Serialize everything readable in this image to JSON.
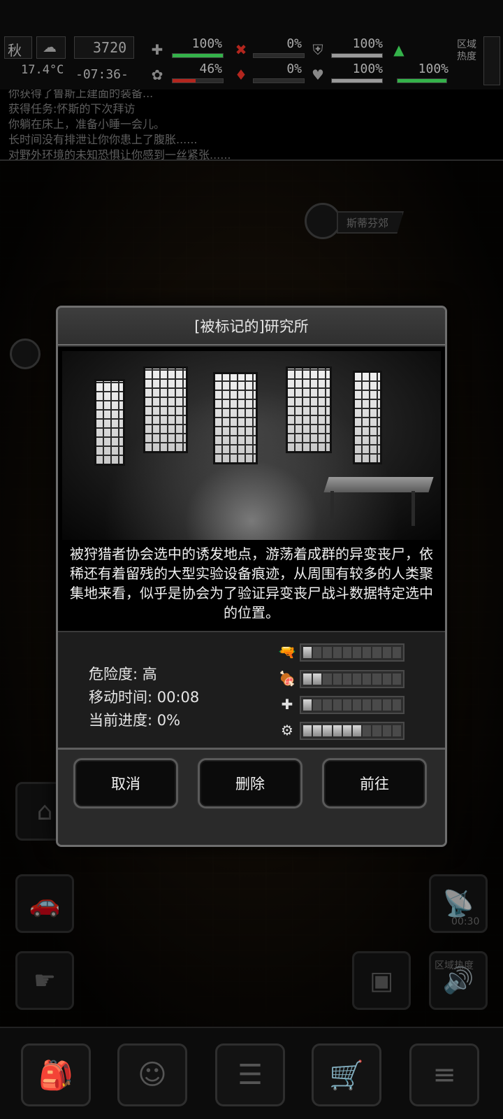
{
  "hud": {
    "season": "秋",
    "temperature": "17.4°C",
    "day_counter": "3720",
    "clock": "-07:36-",
    "weather_icon": "cloud-icon",
    "stats": [
      {
        "name": "health",
        "icon": "medkit-icon",
        "value": "100%",
        "fill": 1.0,
        "color": "#34b24a"
      },
      {
        "name": "stomach",
        "icon": "brain-icon",
        "value": "46%",
        "fill": 0.46,
        "color": "#b3261e"
      },
      {
        "name": "injury",
        "icon": "wound-icon",
        "value": "0%",
        "fill": 0.0,
        "color": "#b3261e"
      },
      {
        "name": "infection",
        "icon": "blood-drop-icon",
        "value": "0%",
        "fill": 0.0,
        "color": "#b3261e"
      },
      {
        "name": "armor",
        "icon": "shield-icon",
        "value": "100%",
        "fill": 1.0,
        "color": "#9a9a9a"
      },
      {
        "name": "mood",
        "icon": "heart-icon",
        "value": "100%",
        "fill": 1.0,
        "color": "#9a9a9a"
      },
      {
        "name": "stamina",
        "icon": "run-icon",
        "value": "100%",
        "fill": 1.0,
        "color": "#34b24a"
      }
    ],
    "area_heat_label": "区域热度"
  },
  "log": {
    "lines": [
      "你获得了鲁斯上建面的装备...",
      "获得任务:怀斯的下次拜访",
      "你躺在床上，准备小睡一会儿。",
      "长时间没有排泄让你你患上了腹胀......",
      "对野外环境的未知恐惧让你感到一丝紧张......"
    ]
  },
  "map": {
    "npc_marker_label": "斯蒂芬郊",
    "radio_timer": "00:30",
    "area_heat_label": "区域热度"
  },
  "dialog": {
    "title": "[被标记的]研究所",
    "description": "被狩猎者协会选中的诱发地点，游荡着成群的异变丧尸，依稀还有着留残的大型实验设备痕迹，从周围有较多的人类聚集地来看，似乎是协会为了验证异变丧尸战斗数据特定选中的位置。",
    "danger": "危险度: 高",
    "travel_time": "移动时间: 00:08",
    "progress": "当前进度: 0%",
    "resources": [
      {
        "name": "weapons",
        "icon": "pistol-icon",
        "level": 1,
        "max": 10
      },
      {
        "name": "food",
        "icon": "meat-icon",
        "level": 2,
        "max": 10
      },
      {
        "name": "medical",
        "icon": "medkit-icon",
        "level": 1,
        "max": 10
      },
      {
        "name": "parts",
        "icon": "gears-icon",
        "level": 6,
        "max": 10
      }
    ],
    "buttons": {
      "cancel": "取消",
      "delete": "删除",
      "go": "前往"
    }
  }
}
